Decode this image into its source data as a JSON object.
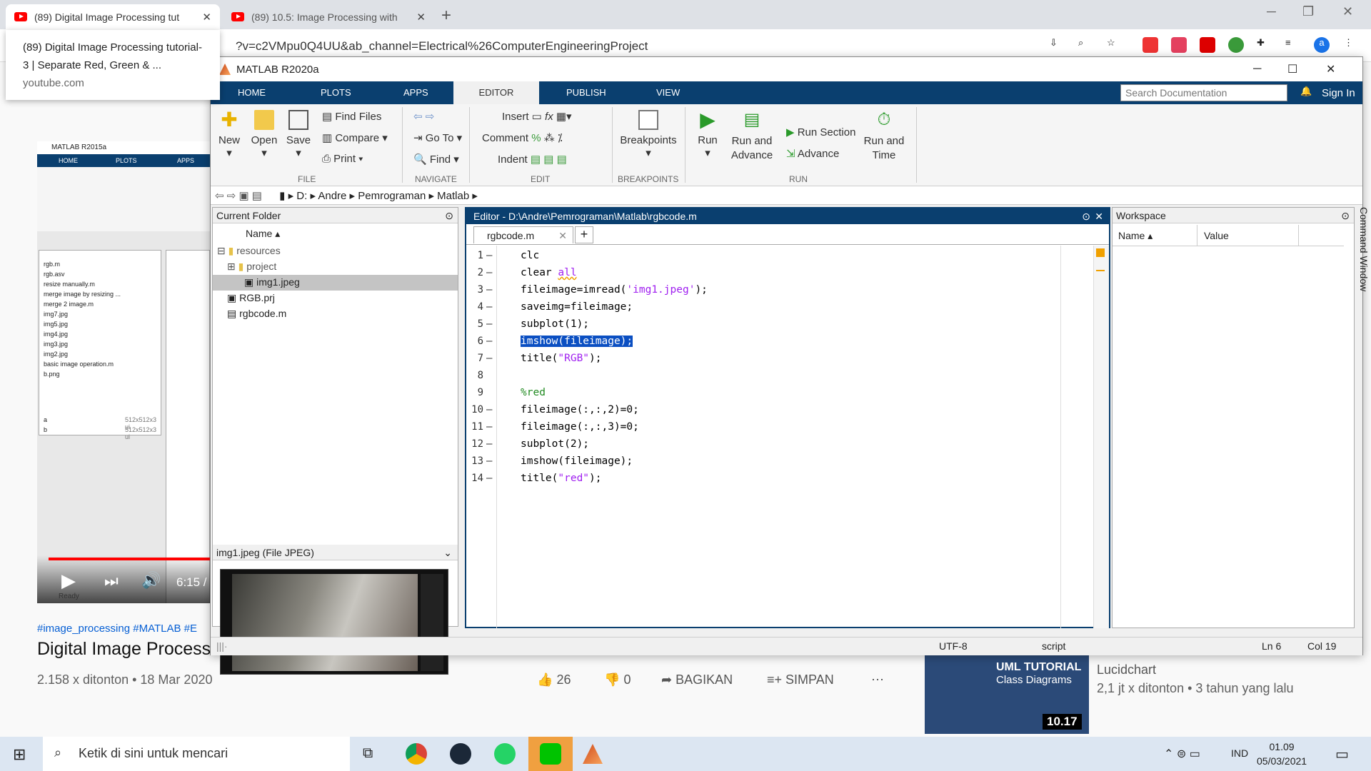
{
  "browser": {
    "tabs": [
      {
        "label": "(89) Digital Image Processing tut",
        "active": true
      },
      {
        "label": "(89) 10.5: Image Processing with",
        "active": false
      }
    ],
    "url": "?v=c2VMpu0Q4UU&ab_channel=Electrical%26ComputerEngineeringProject",
    "tooltip": {
      "title": "(89) Digital Image Processing tutorial-3 | Separate Red, Green & ...",
      "host": "youtube.com"
    }
  },
  "youtube": {
    "hashtags": "#image_processing #MATLAB #E",
    "title": "Digital Image Process",
    "stats": "2.158 x ditonton • 18 Mar 2020",
    "likes": "26",
    "dislikes": "0",
    "share": "BAGIKAN",
    "save": "SIMPAN",
    "video_time": "6:15 /",
    "recommended": {
      "thumb_title": "Class Diagrams",
      "thumb_title_top": "UML TUTORIAL",
      "duration": "10.17",
      "channel": "Lucidchart",
      "meta": "2,1 jt x ditonton • 3 tahun yang lalu"
    },
    "old_matlab": {
      "title": "MATLAB R2015a",
      "tabs": [
        "HOME",
        "PLOTS",
        "APPS"
      ],
      "files": [
        "rgb.m",
        "rgb.asv",
        "resize manually.m",
        "merge image by resizing ...",
        "merge 2 image.m",
        "img7.jpg",
        "img5.jpg",
        "img4.jpg",
        "img3.jpg",
        "img2.jpg",
        "basic image operation.m",
        "b.png"
      ],
      "ws": [
        [
          "a",
          "512x512x3 ui"
        ],
        [
          "b",
          "512x512x3 ui"
        ]
      ],
      "status": "Ready"
    }
  },
  "matlab": {
    "title": "MATLAB R2020a",
    "tabs": [
      "HOME",
      "PLOTS",
      "APPS",
      "EDITOR",
      "PUBLISH",
      "VIEW"
    ],
    "search_placeholder": "Search Documentation",
    "signin": "Sign In",
    "ribbon": {
      "file": {
        "new": "New",
        "open": "Open",
        "save": "Save",
        "find_files": "Find Files",
        "compare": "Compare",
        "print": "Print",
        "group": "FILE"
      },
      "navigate": {
        "goto": "Go To",
        "find": "Find",
        "group": "NAVIGATE"
      },
      "edit": {
        "insert": "Insert",
        "comment": "Comment",
        "indent": "Indent",
        "group": "EDIT"
      },
      "breakpoints": {
        "label": "Breakpoints",
        "group": "BREAKPOINTS"
      },
      "run": {
        "run": "Run",
        "run_advance": "Run and Advance",
        "run_section": "Run Section",
        "advance": "Advance",
        "run_time": "Run and Time",
        "group": "RUN"
      }
    },
    "path": [
      "D:",
      "Andre",
      "Pemrograman",
      "Matlab"
    ],
    "current_folder": {
      "title": "Current Folder",
      "col": "Name",
      "items": [
        "resources",
        "project",
        "img1.jpeg",
        "RGB.prj",
        "rgbcode.m"
      ],
      "preview_title": "img1.jpeg  (File JPEG)"
    },
    "editor": {
      "title": "Editor - D:\\Andre\\Pemrograman\\Matlab\\rgbcode.m",
      "tab": "rgbcode.m",
      "lines": [
        "1",
        "2",
        "3",
        "4",
        "5",
        "6",
        "7",
        "8",
        "9",
        "10",
        "11",
        "12",
        "13",
        "14"
      ]
    },
    "workspace": {
      "title": "Workspace",
      "col_name": "Name",
      "col_value": "Value"
    },
    "command_window": "Command Window",
    "status": {
      "encoding": "UTF-8",
      "type": "script",
      "ln": "Ln  6",
      "col": "Col  19"
    }
  },
  "taskbar": {
    "search": "Ketik di sini untuk mencari",
    "lang": "IND",
    "time": "01.09",
    "date": "05/03/2021"
  }
}
